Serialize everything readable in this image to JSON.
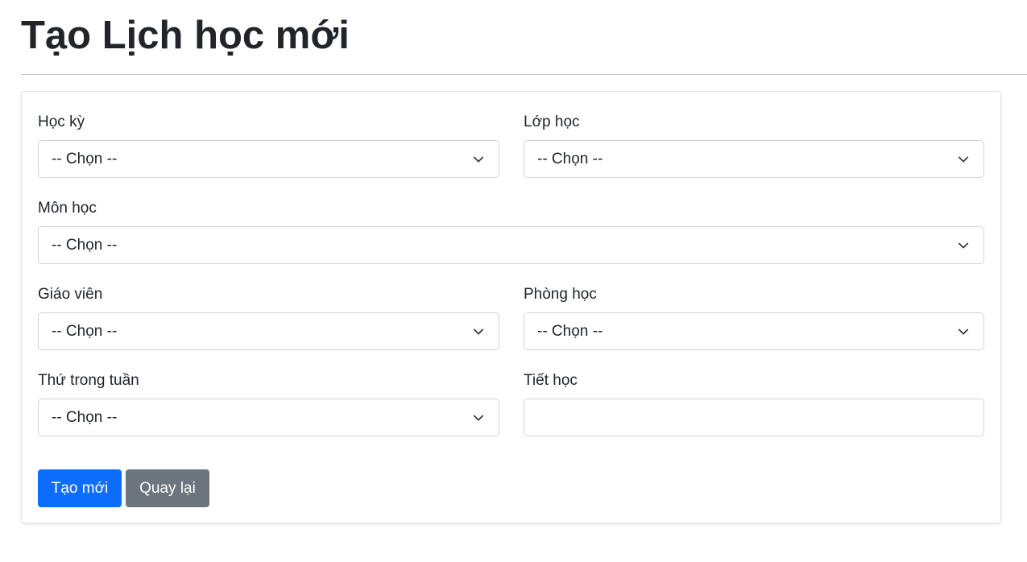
{
  "page": {
    "title": "Tạo Lịch học mới"
  },
  "form": {
    "hoc_ky": {
      "label": "Học kỳ",
      "value": "-- Chọn --"
    },
    "lop_hoc": {
      "label": "Lớp học",
      "value": "-- Chọn --"
    },
    "mon_hoc": {
      "label": "Môn học",
      "value": "-- Chọn --"
    },
    "giao_vien": {
      "label": "Giáo viên",
      "value": "-- Chọn --"
    },
    "phong_hoc": {
      "label": "Phòng học",
      "value": "-- Chọn --"
    },
    "thu_trong_tuan": {
      "label": "Thứ trong tuần",
      "value": "-- Chọn --"
    },
    "tiet_hoc": {
      "label": "Tiết học",
      "value": ""
    }
  },
  "actions": {
    "create_label": "Tạo mới",
    "back_label": "Quay lại"
  },
  "colors": {
    "primary": "#0d6efd",
    "secondary": "#6c757d",
    "border": "#ced4da",
    "text": "#212529"
  },
  "icons": {
    "select_indicator": "chevron-down-icon"
  }
}
